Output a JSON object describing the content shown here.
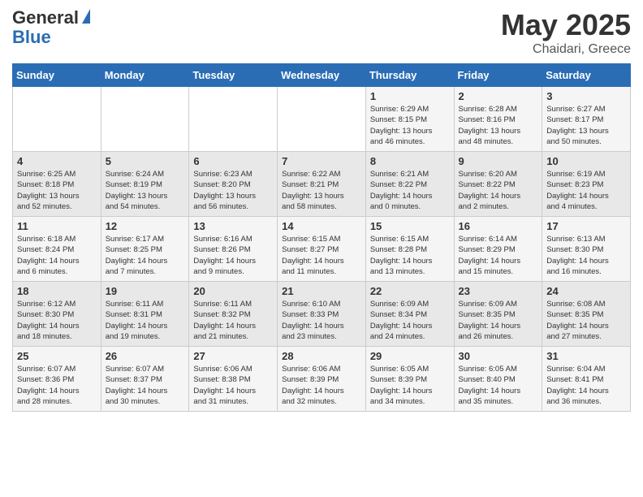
{
  "logo": {
    "general": "General",
    "blue": "Blue"
  },
  "title": {
    "month_year": "May 2025",
    "location": "Chaidari, Greece"
  },
  "days_of_week": [
    "Sunday",
    "Monday",
    "Tuesday",
    "Wednesday",
    "Thursday",
    "Friday",
    "Saturday"
  ],
  "weeks": [
    [
      {
        "day": "",
        "info": ""
      },
      {
        "day": "",
        "info": ""
      },
      {
        "day": "",
        "info": ""
      },
      {
        "day": "",
        "info": ""
      },
      {
        "day": "1",
        "info": "Sunrise: 6:29 AM\nSunset: 8:15 PM\nDaylight: 13 hours\nand 46 minutes."
      },
      {
        "day": "2",
        "info": "Sunrise: 6:28 AM\nSunset: 8:16 PM\nDaylight: 13 hours\nand 48 minutes."
      },
      {
        "day": "3",
        "info": "Sunrise: 6:27 AM\nSunset: 8:17 PM\nDaylight: 13 hours\nand 50 minutes."
      }
    ],
    [
      {
        "day": "4",
        "info": "Sunrise: 6:25 AM\nSunset: 8:18 PM\nDaylight: 13 hours\nand 52 minutes."
      },
      {
        "day": "5",
        "info": "Sunrise: 6:24 AM\nSunset: 8:19 PM\nDaylight: 13 hours\nand 54 minutes."
      },
      {
        "day": "6",
        "info": "Sunrise: 6:23 AM\nSunset: 8:20 PM\nDaylight: 13 hours\nand 56 minutes."
      },
      {
        "day": "7",
        "info": "Sunrise: 6:22 AM\nSunset: 8:21 PM\nDaylight: 13 hours\nand 58 minutes."
      },
      {
        "day": "8",
        "info": "Sunrise: 6:21 AM\nSunset: 8:22 PM\nDaylight: 14 hours\nand 0 minutes."
      },
      {
        "day": "9",
        "info": "Sunrise: 6:20 AM\nSunset: 8:22 PM\nDaylight: 14 hours\nand 2 minutes."
      },
      {
        "day": "10",
        "info": "Sunrise: 6:19 AM\nSunset: 8:23 PM\nDaylight: 14 hours\nand 4 minutes."
      }
    ],
    [
      {
        "day": "11",
        "info": "Sunrise: 6:18 AM\nSunset: 8:24 PM\nDaylight: 14 hours\nand 6 minutes."
      },
      {
        "day": "12",
        "info": "Sunrise: 6:17 AM\nSunset: 8:25 PM\nDaylight: 14 hours\nand 7 minutes."
      },
      {
        "day": "13",
        "info": "Sunrise: 6:16 AM\nSunset: 8:26 PM\nDaylight: 14 hours\nand 9 minutes."
      },
      {
        "day": "14",
        "info": "Sunrise: 6:15 AM\nSunset: 8:27 PM\nDaylight: 14 hours\nand 11 minutes."
      },
      {
        "day": "15",
        "info": "Sunrise: 6:15 AM\nSunset: 8:28 PM\nDaylight: 14 hours\nand 13 minutes."
      },
      {
        "day": "16",
        "info": "Sunrise: 6:14 AM\nSunset: 8:29 PM\nDaylight: 14 hours\nand 15 minutes."
      },
      {
        "day": "17",
        "info": "Sunrise: 6:13 AM\nSunset: 8:30 PM\nDaylight: 14 hours\nand 16 minutes."
      }
    ],
    [
      {
        "day": "18",
        "info": "Sunrise: 6:12 AM\nSunset: 8:30 PM\nDaylight: 14 hours\nand 18 minutes."
      },
      {
        "day": "19",
        "info": "Sunrise: 6:11 AM\nSunset: 8:31 PM\nDaylight: 14 hours\nand 19 minutes."
      },
      {
        "day": "20",
        "info": "Sunrise: 6:11 AM\nSunset: 8:32 PM\nDaylight: 14 hours\nand 21 minutes."
      },
      {
        "day": "21",
        "info": "Sunrise: 6:10 AM\nSunset: 8:33 PM\nDaylight: 14 hours\nand 23 minutes."
      },
      {
        "day": "22",
        "info": "Sunrise: 6:09 AM\nSunset: 8:34 PM\nDaylight: 14 hours\nand 24 minutes."
      },
      {
        "day": "23",
        "info": "Sunrise: 6:09 AM\nSunset: 8:35 PM\nDaylight: 14 hours\nand 26 minutes."
      },
      {
        "day": "24",
        "info": "Sunrise: 6:08 AM\nSunset: 8:35 PM\nDaylight: 14 hours\nand 27 minutes."
      }
    ],
    [
      {
        "day": "25",
        "info": "Sunrise: 6:07 AM\nSunset: 8:36 PM\nDaylight: 14 hours\nand 28 minutes."
      },
      {
        "day": "26",
        "info": "Sunrise: 6:07 AM\nSunset: 8:37 PM\nDaylight: 14 hours\nand 30 minutes."
      },
      {
        "day": "27",
        "info": "Sunrise: 6:06 AM\nSunset: 8:38 PM\nDaylight: 14 hours\nand 31 minutes."
      },
      {
        "day": "28",
        "info": "Sunrise: 6:06 AM\nSunset: 8:39 PM\nDaylight: 14 hours\nand 32 minutes."
      },
      {
        "day": "29",
        "info": "Sunrise: 6:05 AM\nSunset: 8:39 PM\nDaylight: 14 hours\nand 34 minutes."
      },
      {
        "day": "30",
        "info": "Sunrise: 6:05 AM\nSunset: 8:40 PM\nDaylight: 14 hours\nand 35 minutes."
      },
      {
        "day": "31",
        "info": "Sunrise: 6:04 AM\nSunset: 8:41 PM\nDaylight: 14 hours\nand 36 minutes."
      }
    ]
  ]
}
